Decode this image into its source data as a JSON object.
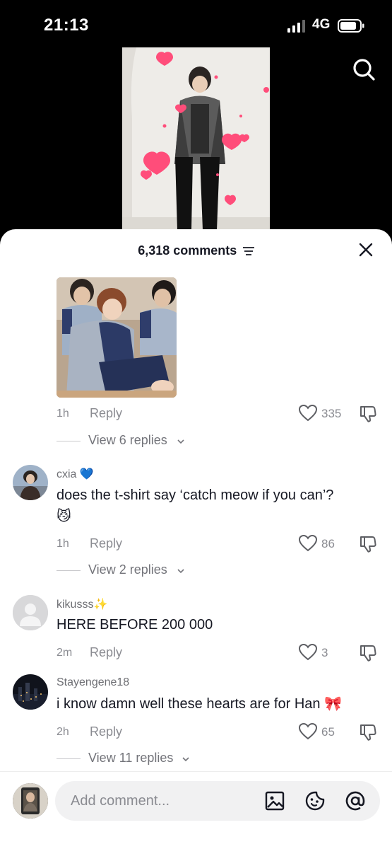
{
  "status": {
    "time": "21:13",
    "network": "4G"
  },
  "sheet": {
    "comment_count": "6,318 comments"
  },
  "first_comment": {
    "ago": "1h",
    "reply": "Reply",
    "likes": "335",
    "view_replies": "View 6 replies"
  },
  "comments": [
    {
      "username": "cxia",
      "badge": "💙",
      "text": "does the t-shirt say ‘catch meow if you can’?",
      "emoji": "😼",
      "ago": "1h",
      "reply": "Reply",
      "likes": "86",
      "view_replies": "View 2 replies"
    },
    {
      "username": "kikusss",
      "badge": "✨",
      "text": "HERE BEFORE 200 000",
      "ago": "2m",
      "reply": "Reply",
      "likes": "3"
    },
    {
      "username": "Stayengene18",
      "text": "i know damn well these hearts are for Han 🎀",
      "ago": "2h",
      "reply": "Reply",
      "likes": "65",
      "view_replies": "View 11 replies"
    }
  ],
  "composer": {
    "placeholder": "Add comment..."
  },
  "colors": {
    "heart": "#ff4d7a",
    "text": "#161823",
    "muted": "#8a8b91"
  }
}
